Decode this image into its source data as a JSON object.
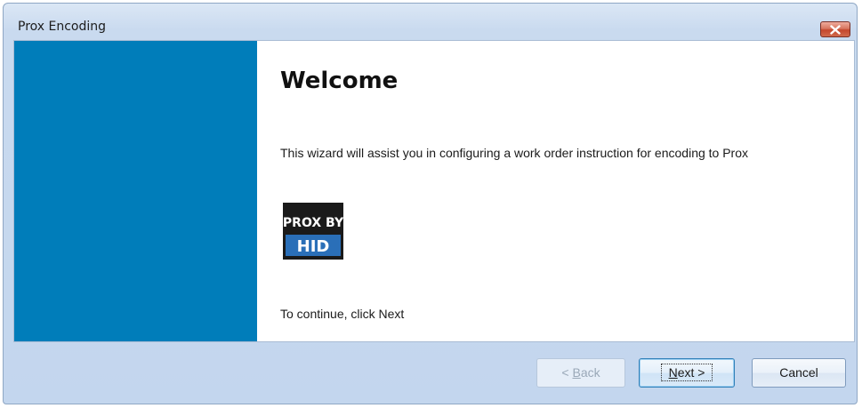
{
  "window": {
    "title": "Prox Encoding"
  },
  "wizard": {
    "heading": "Welcome",
    "intro": "This wizard will assist you in configuring a work order instruction for encoding to Prox",
    "logo_line1": "PROX BY",
    "logo_line2": "HID",
    "continue_text": "To continue, click Next"
  },
  "buttons": {
    "back": {
      "prefix": "< ",
      "accel": "B",
      "rest": "ack"
    },
    "next": {
      "accel": "N",
      "rest": "ext >"
    },
    "cancel": "Cancel"
  },
  "colors": {
    "sidebar": "#007dba",
    "close_button": "#c4472d"
  },
  "icons": {
    "close": "close-icon",
    "logo": "prox-by-hid-logo"
  }
}
